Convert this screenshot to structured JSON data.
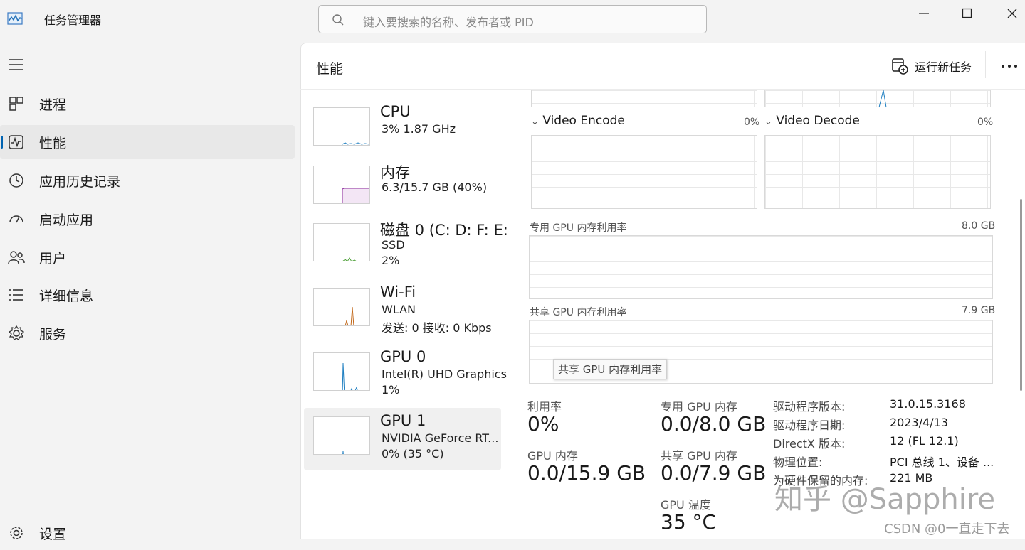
{
  "titlebar": {
    "app_title": "任务管理器",
    "search_placeholder": "键入要搜索的名称、发布者或 PID"
  },
  "sidebar": {
    "items": [
      {
        "label": "进程",
        "icon": "processes-icon"
      },
      {
        "label": "性能",
        "icon": "performance-icon",
        "active": true
      },
      {
        "label": "应用历史记录",
        "icon": "app-history-icon"
      },
      {
        "label": "启动应用",
        "icon": "startup-apps-icon"
      },
      {
        "label": "用户",
        "icon": "users-icon"
      },
      {
        "label": "详细信息",
        "icon": "details-icon"
      },
      {
        "label": "服务",
        "icon": "services-icon"
      }
    ],
    "settings_label": "设置"
  },
  "header": {
    "page_title": "性能",
    "run_task_label": "运行新任务"
  },
  "devices": [
    {
      "name": "CPU",
      "line1": "3%  1.87 GHz",
      "line2": ""
    },
    {
      "name": "内存",
      "line1": "6.3/15.7 GB (40%)",
      "line2": ""
    },
    {
      "name": "磁盘 0 (C: D: F: E:",
      "line1": "SSD",
      "line2": "2%"
    },
    {
      "name": "Wi-Fi",
      "line1": "WLAN",
      "line2": "发送: 0 接收: 0 Kbps"
    },
    {
      "name": "GPU 0",
      "line1": "Intel(R) UHD Graphics",
      "line2": "1%"
    },
    {
      "name": "GPU 1",
      "line1": "NVIDIA GeForce RT...",
      "line2": "0%  (35 °C)",
      "active": true
    }
  ],
  "graphs": {
    "video_encode": {
      "title": "Video Encode",
      "pct": "0%"
    },
    "video_decode": {
      "title": "Video Decode",
      "pct": "0%"
    },
    "dedicated_mem": {
      "title": "专用 GPU 内存利用率",
      "max": "8.0 GB"
    },
    "shared_mem": {
      "title": "共享 GPU 内存利用率",
      "max": "7.9 GB"
    },
    "tooltip": "共享 GPU 内存利用率"
  },
  "stats": {
    "utilization": {
      "label": "利用率",
      "value": "0%"
    },
    "gpu_memory": {
      "label": "GPU 内存",
      "value": "0.0/15.9 GB"
    },
    "dedicated": {
      "label": "专用 GPU 内存",
      "value": "0.0/8.0 GB"
    },
    "shared": {
      "label": "共享 GPU 内存",
      "value": "0.0/7.9 GB"
    },
    "temperature": {
      "label": "GPU 温度",
      "value": "35 °C"
    }
  },
  "info": [
    {
      "key": "驱动程序版本:",
      "value": "31.0.15.3168"
    },
    {
      "key": "驱动程序日期:",
      "value": "2023/4/13"
    },
    {
      "key": "DirectX 版本:",
      "value": "12 (FL 12.1)"
    },
    {
      "key": "物理位置:",
      "value": "PCI 总线 1、设备 ..."
    },
    {
      "key": "为硬件保留的内存:",
      "value": "221 MB"
    }
  ],
  "watermarks": {
    "zhihu": "知乎 @Sapphire",
    "csdn": "CSDN @0一直走下去"
  },
  "colors": {
    "accent": "#0063b1",
    "cpu": "#1f7fc1",
    "memory": "#8b2a9b",
    "disk": "#4fa13a",
    "wifi": "#c2681a",
    "gpu": "#1f7fc1"
  }
}
